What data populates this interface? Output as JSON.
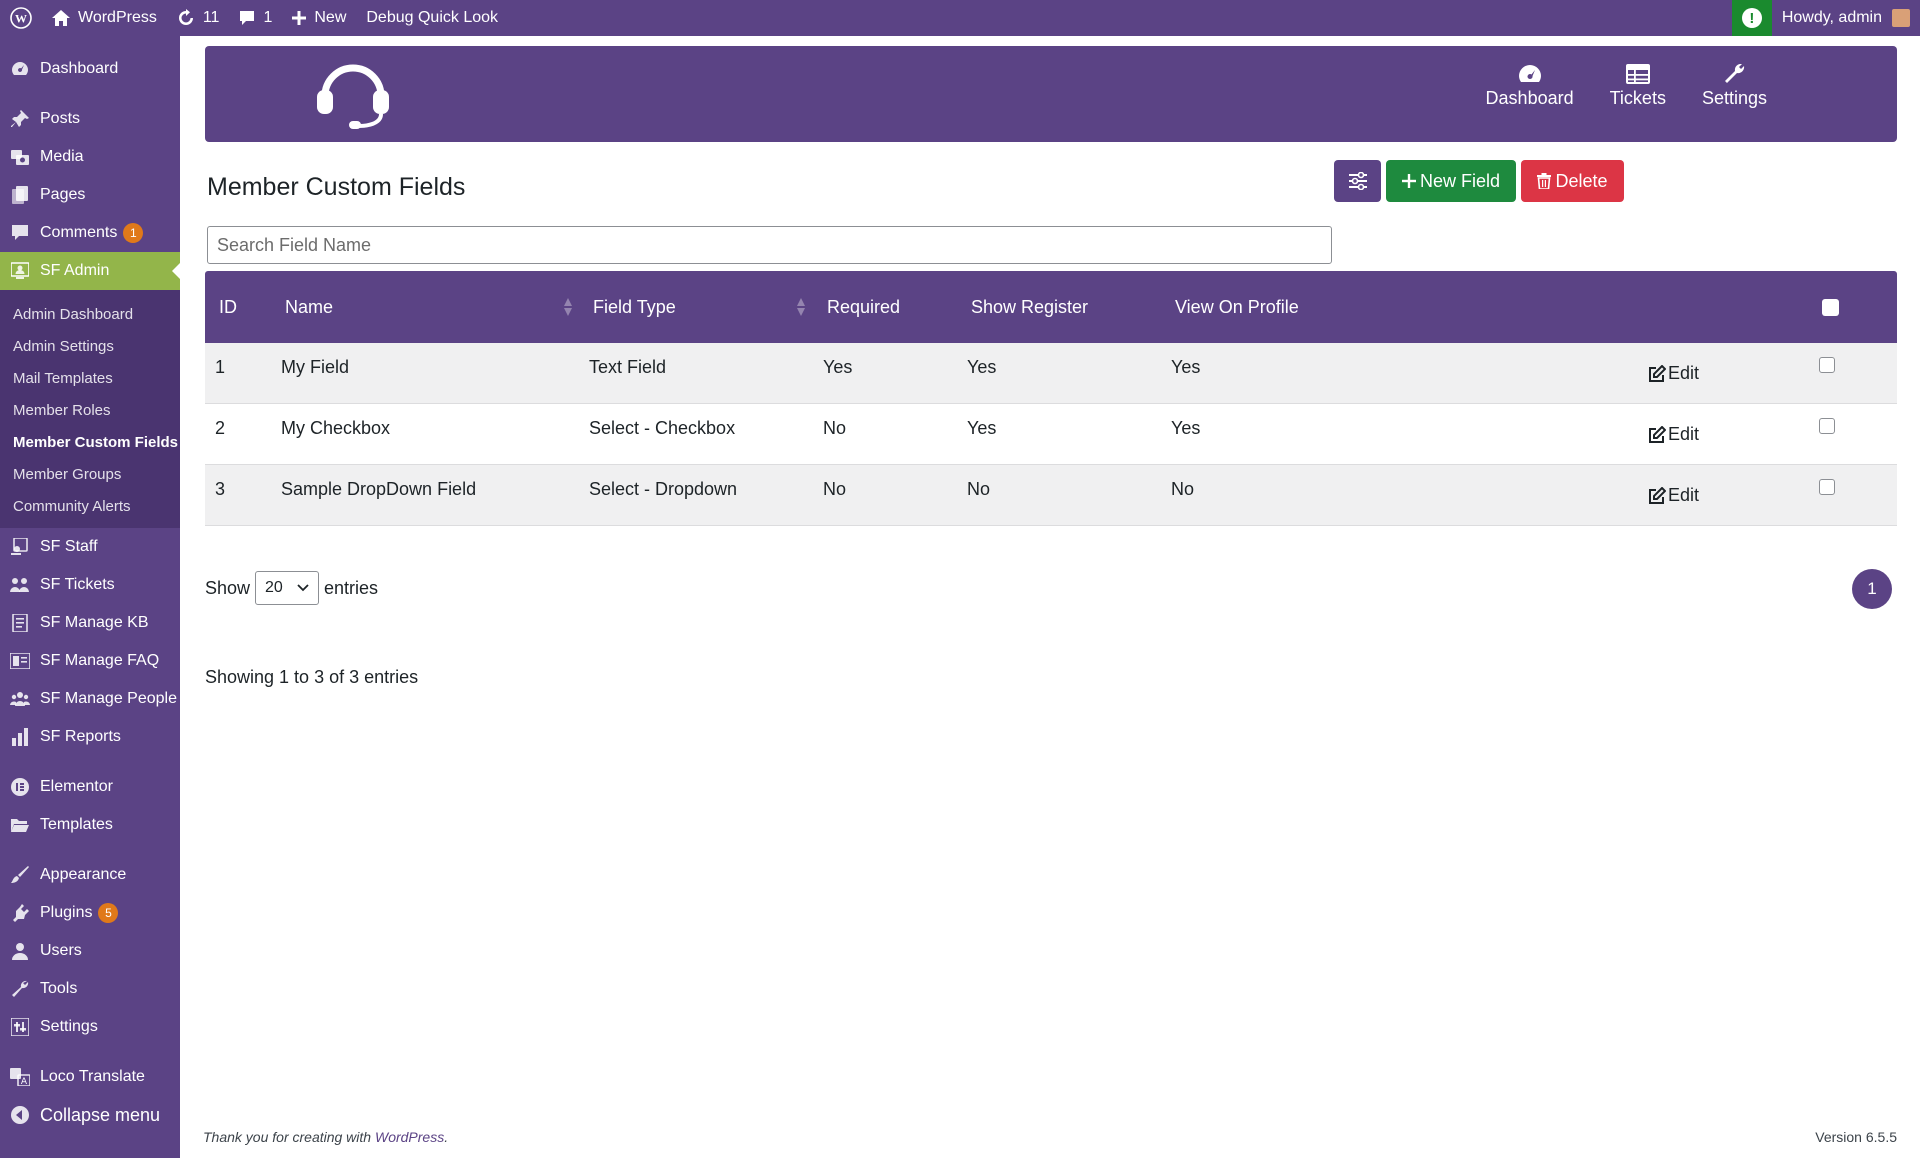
{
  "adminbar": {
    "site_name": "WordPress",
    "updates_count": "11",
    "comments_count": "1",
    "new_label": "New",
    "debug_label": "Debug Quick Look",
    "howdy": "Howdy, admin"
  },
  "sidebar": {
    "dashboard": "Dashboard",
    "posts": "Posts",
    "media": "Media",
    "pages": "Pages",
    "comments": "Comments",
    "comments_badge": "1",
    "sf_admin": "SF Admin",
    "submenu": [
      "Admin Dashboard",
      "Admin Settings",
      "Mail Templates",
      "Member Roles",
      "Member Custom Fields",
      "Member Groups",
      "Community Alerts"
    ],
    "sf_staff": "SF Staff",
    "sf_tickets": "SF Tickets",
    "sf_manage_kb": "SF Manage KB",
    "sf_manage_faq": "SF Manage FAQ",
    "sf_manage_people": "SF Manage People",
    "sf_reports": "SF Reports",
    "elementor": "Elementor",
    "templates": "Templates",
    "appearance": "Appearance",
    "plugins": "Plugins",
    "plugins_badge": "5",
    "users": "Users",
    "tools": "Tools",
    "settings": "Settings",
    "loco_translate": "Loco Translate",
    "collapse": "Collapse menu"
  },
  "plugin_nav": {
    "dashboard": "Dashboard",
    "tickets": "Tickets",
    "settings": "Settings"
  },
  "page": {
    "title": "Member Custom Fields",
    "new_field": "New Field",
    "delete": "Delete",
    "search_placeholder": "Search Field Name"
  },
  "table": {
    "headers": {
      "id": "ID",
      "name": "Name",
      "field_type": "Field Type",
      "required": "Required",
      "show_register": "Show Register",
      "view_on_profile": "View On Profile"
    },
    "rows": [
      {
        "id": "1",
        "name": "My Field",
        "type": "Text Field",
        "required": "Yes",
        "register": "Yes",
        "profile": "Yes",
        "edit": "Edit"
      },
      {
        "id": "2",
        "name": "My Checkbox",
        "type": "Select - Checkbox",
        "required": "No",
        "register": "Yes",
        "profile": "Yes",
        "edit": "Edit"
      },
      {
        "id": "3",
        "name": "Sample DropDown Field",
        "type": "Select - Dropdown",
        "required": "No",
        "register": "No",
        "profile": "No",
        "edit": "Edit"
      }
    ]
  },
  "pagination": {
    "show": "Show",
    "entries_value": "20",
    "entries": "entries",
    "page": "1",
    "info": "Showing 1 to 3 of 3 entries"
  },
  "footer": {
    "thanks_prefix": "Thank you for creating with ",
    "wordpress_link": "WordPress",
    "thanks_suffix": ".",
    "version": "Version 6.5.5"
  },
  "colors": {
    "primary_purple": "#5b4385",
    "active_green": "#93b54a",
    "success": "#1e8a3e",
    "danger": "#dc3545"
  }
}
